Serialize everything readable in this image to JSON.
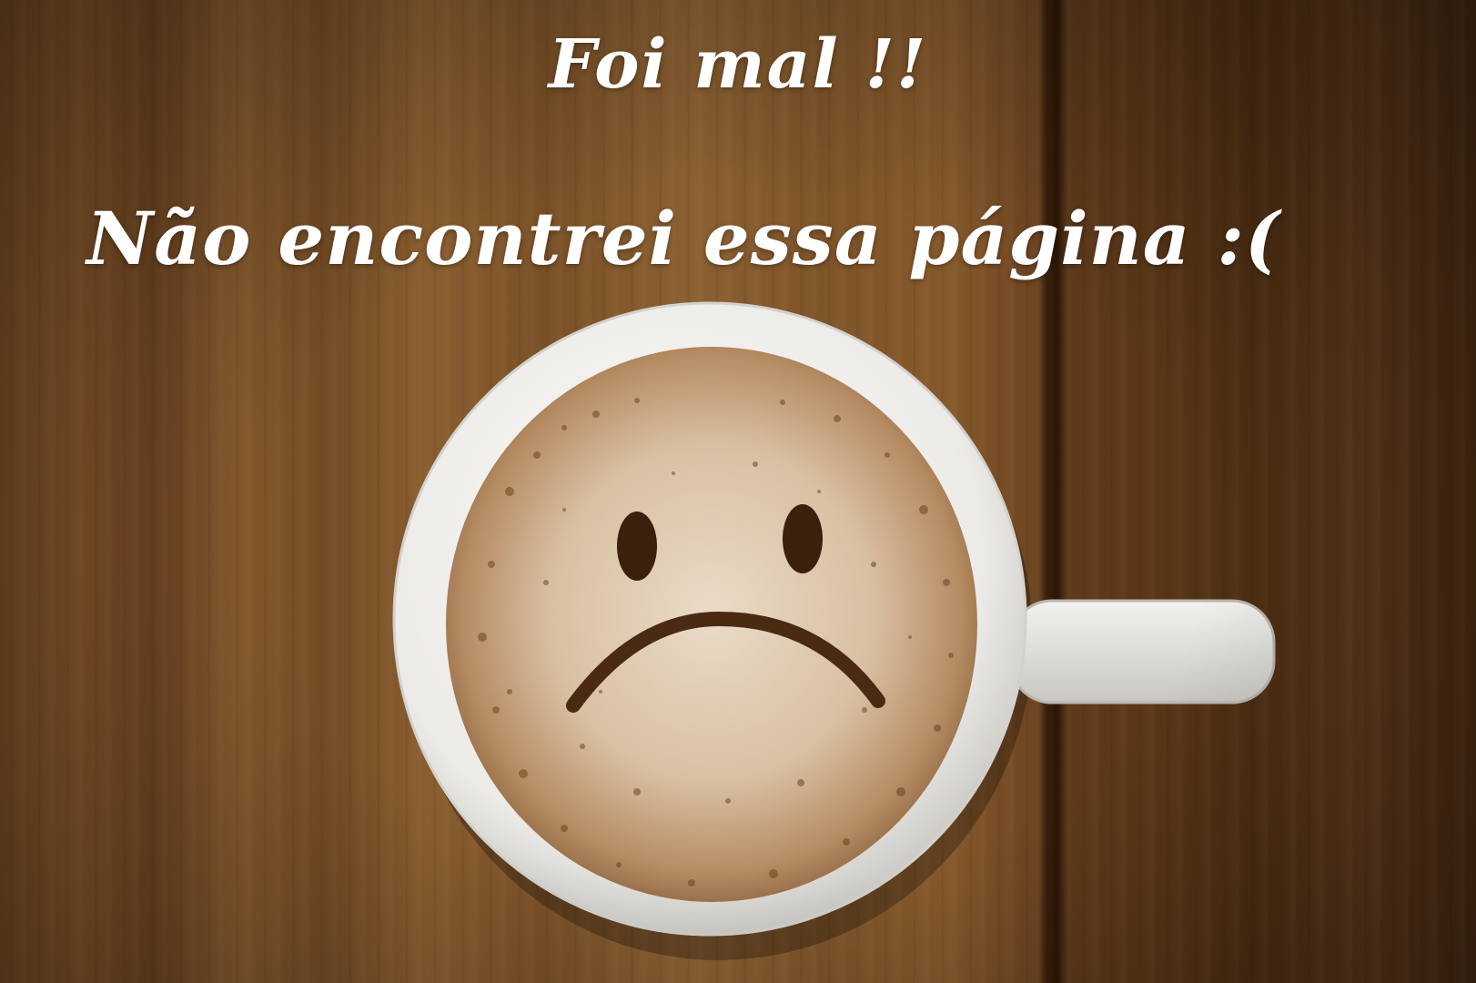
{
  "error_page": {
    "title_line_1": "Foi mal !!",
    "title_line_2": "Não encontrei essa página :(",
    "illustration": "sad-face-coffee-cup"
  },
  "colors": {
    "text": "#ffffff",
    "wood": "#7b4f26",
    "cup": "#f2f0ec",
    "foam": "#c9a580"
  }
}
